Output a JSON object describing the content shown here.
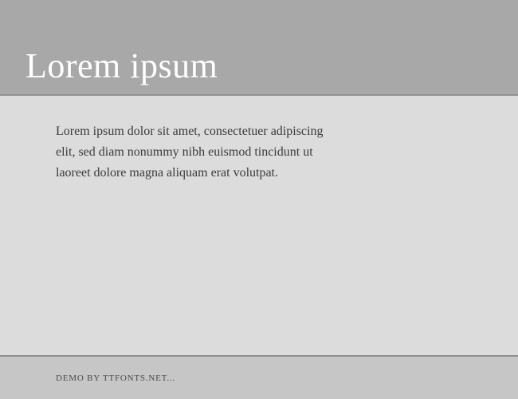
{
  "header": {
    "title": "Lorem ipsum"
  },
  "body": {
    "paragraph": "Lorem ipsum dolor sit amet, consectetuer adipiscing elit, sed diam nonummy nibh euismod tincidunt ut laoreet dolore magna aliquam erat volutpat."
  },
  "footer": {
    "credit": "DEMO BY TTFONTS.NET..."
  }
}
